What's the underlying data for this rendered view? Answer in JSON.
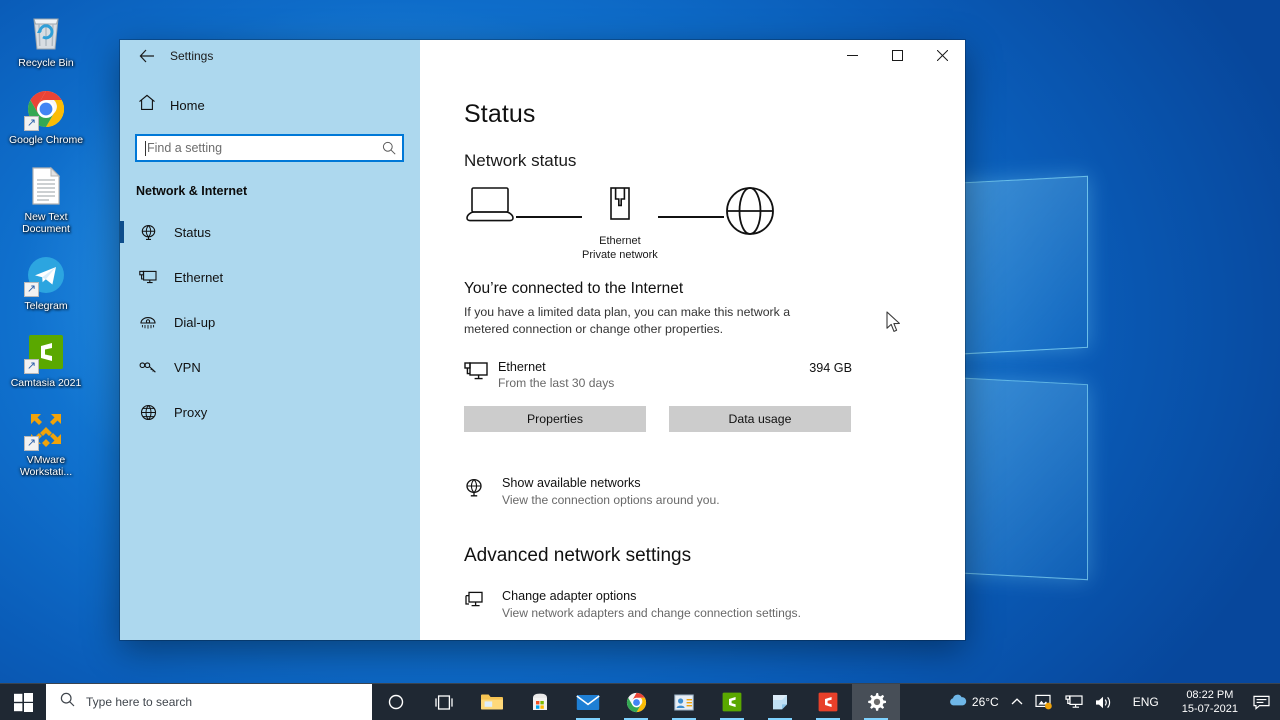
{
  "desktop": {
    "icons": [
      {
        "label": "Recycle Bin",
        "icon": "recycle-bin-icon",
        "shortcut": false
      },
      {
        "label": "Google Chrome",
        "icon": "chrome-icon",
        "shortcut": true
      },
      {
        "label": "New Text Document",
        "icon": "text-document-icon",
        "shortcut": false
      },
      {
        "label": "Telegram",
        "icon": "telegram-icon",
        "shortcut": true
      },
      {
        "label": "Camtasia 2021",
        "icon": "camtasia-icon",
        "shortcut": true
      },
      {
        "label": "VMware Workstati...",
        "icon": "vmware-icon",
        "shortcut": true
      }
    ]
  },
  "window": {
    "title": "Settings",
    "back_label": "Back",
    "controls": {
      "minimize": "─",
      "maximize": "□",
      "close": "✕"
    }
  },
  "sidebar": {
    "home_label": "Home",
    "search": {
      "placeholder": "Find a setting",
      "value": "",
      "icon": "search-icon"
    },
    "group_title": "Network & Internet",
    "items": [
      {
        "label": "Status",
        "icon": "globe-status-icon",
        "selected": true
      },
      {
        "label": "Ethernet",
        "icon": "ethernet-icon",
        "selected": false
      },
      {
        "label": "Dial-up",
        "icon": "dialup-icon",
        "selected": false
      },
      {
        "label": "VPN",
        "icon": "vpn-icon",
        "selected": false
      },
      {
        "label": "Proxy",
        "icon": "proxy-globe-icon",
        "selected": false
      }
    ]
  },
  "main": {
    "page_title": "Status",
    "network_status_title": "Network status",
    "diagram": {
      "device_icon": "laptop-icon",
      "network_icon": "ethernet-port-icon",
      "internet_icon": "globe-icon",
      "network_name": "Ethernet",
      "network_type": "Private network"
    },
    "connection_heading": "You’re connected to the Internet",
    "connection_description": "If you have a limited data plan, you can make this network a metered connection or change other properties.",
    "adapter": {
      "icon": "pc-monitor-icon",
      "name": "Ethernet",
      "period": "From the last 30 days",
      "usage": "394 GB"
    },
    "buttons": {
      "properties": "Properties",
      "data_usage": "Data usage"
    },
    "links": [
      {
        "icon": "globe-network-icon",
        "title": "Show available networks",
        "subtitle": "View the connection options around you."
      }
    ],
    "advanced_title": "Advanced network settings",
    "advanced_links": [
      {
        "icon": "adapter-monitor-icon",
        "title": "Change adapter options",
        "subtitle": "View network adapters and change connection settings."
      }
    ]
  },
  "taskbar": {
    "start_label": "Start",
    "search_placeholder": "Type here to search",
    "search_icon": "search-icon",
    "apps": [
      {
        "name": "task-view-icon",
        "label": "Task View"
      },
      {
        "name": "file-explorer-icon",
        "label": "File Explorer"
      },
      {
        "name": "microsoft-store-icon",
        "label": "Microsoft Store"
      },
      {
        "name": "mail-icon",
        "label": "Mail"
      },
      {
        "name": "chrome-icon",
        "label": "Google Chrome"
      },
      {
        "name": "contacts-icon",
        "label": "Contacts"
      },
      {
        "name": "camtasia-icon",
        "label": "Camtasia 2021"
      },
      {
        "name": "sticky-notes-icon",
        "label": "Sticky Notes"
      },
      {
        "name": "camtasia-recorder-icon",
        "label": "Camtasia Recorder"
      },
      {
        "name": "settings-gear-icon",
        "label": "Settings"
      }
    ],
    "tray": {
      "weather_icon": "cloud-icon",
      "temperature": "26°C",
      "chevron": "∧",
      "icons": [
        {
          "name": "onedrive-tray-icon"
        },
        {
          "name": "network-tray-icon"
        },
        {
          "name": "volume-tray-icon"
        }
      ],
      "language": "ENG",
      "time": "08:22 PM",
      "date": "15-07-2021",
      "action_center_icon": "notification-icon"
    }
  },
  "colors": {
    "accent": "#0078d7",
    "sidebar_bg": "#add8ee",
    "selection_bar": "#0d4d8c",
    "taskbar_bg": "#1f2833",
    "button_bg": "#cccccc"
  }
}
